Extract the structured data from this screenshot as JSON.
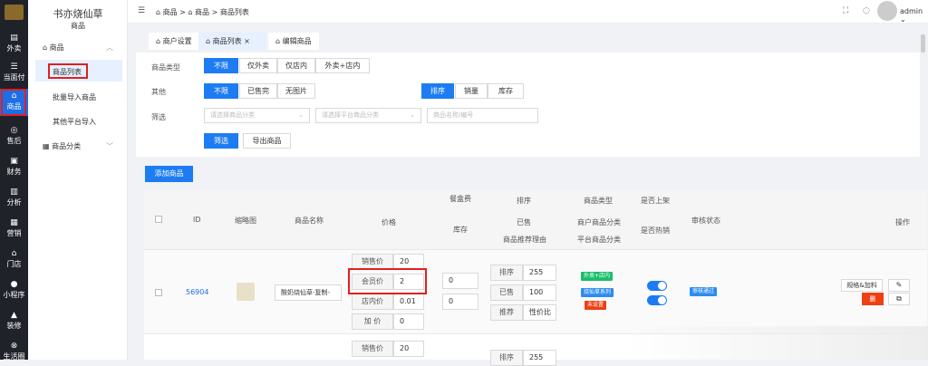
{
  "rail": {
    "items": [
      {
        "label": "外卖",
        "icon": "takeout-icon"
      },
      {
        "label": "当面付",
        "icon": "list-icon"
      },
      {
        "label": "商品",
        "icon": "shop-icon"
      },
      {
        "label": "售后",
        "icon": "headset-icon"
      },
      {
        "label": "财务",
        "icon": "finance-icon"
      },
      {
        "label": "分析",
        "icon": "chart-icon"
      },
      {
        "label": "营销",
        "icon": "marketing-icon"
      },
      {
        "label": "门店",
        "icon": "store-icon"
      },
      {
        "label": "小程序",
        "icon": "wechat-icon"
      },
      {
        "label": "装修",
        "icon": "decorate-icon"
      },
      {
        "label": "生活圈",
        "icon": "circle-icon"
      }
    ]
  },
  "subnav": {
    "brand": "书亦烧仙草",
    "section": "商品",
    "group1": "商品",
    "items": [
      "商品列表",
      "批量导入商品",
      "其他平台导入"
    ],
    "group2": "商品分类"
  },
  "breadcrumb": [
    "商品",
    "商品",
    "商品列表"
  ],
  "user": {
    "name": "admin"
  },
  "tabs": [
    "商户设置",
    "商品列表",
    "编辑商品"
  ],
  "filters": {
    "type_label": "商品类型",
    "type_options": [
      "不限",
      "仅外卖",
      "仅店内",
      "外卖+店内"
    ],
    "other_label": "其他",
    "other_options": [
      "不限",
      "已售完",
      "无图片"
    ],
    "sort_options": [
      "排序",
      "销量",
      "库存"
    ],
    "filter_label": "筛选",
    "category_placeholder": "请选择商品分类",
    "platform_placeholder": "请选择平台商品分类",
    "search_placeholder": "商品名称/编号",
    "filter_button": "筛选",
    "export_button": "导出商品"
  },
  "add_button": "添加商品",
  "table": {
    "headers": {
      "id": "ID",
      "thumb": "缩略图",
      "name": "商品名称",
      "price": "价格",
      "box_fee": "餐盒费",
      "stock": "库存",
      "sort": "排序",
      "sold": "已售",
      "reason": "商品推荐理由",
      "goods_type": "商品类型",
      "merchant_cat": "商户商品分类",
      "platform_cat": "平台商品分类",
      "on_shelf": "是否上架",
      "hot": "是否热销",
      "audit": "审核状态",
      "ops": "操作"
    },
    "row": {
      "id": "56904",
      "name": "酸奶烧仙草-复制-",
      "price_labels": [
        "销售价",
        "会员价",
        "店内价",
        "加 价"
      ],
      "price_values": [
        "20",
        "2",
        "0.01",
        "0"
      ],
      "box_fee": "0",
      "stock": "0",
      "sort_labels": [
        "排序",
        "已售",
        "推荐"
      ],
      "sort_values": [
        "255",
        "100",
        "性价比"
      ],
      "tags": [
        {
          "text": "外卖+店内",
          "color": "#19be6b"
        },
        {
          "text": "烧仙草系列",
          "color": "#2d8cf0"
        },
        {
          "text": "未设置",
          "color": "#ed4014"
        }
      ],
      "audit": "审核通过",
      "op_spec": "规格&加料",
      "op_delete": "删"
    },
    "row2": {
      "price_label": "销售价",
      "price_value": "20",
      "sort_label": "排序",
      "sort_value": "255"
    }
  }
}
